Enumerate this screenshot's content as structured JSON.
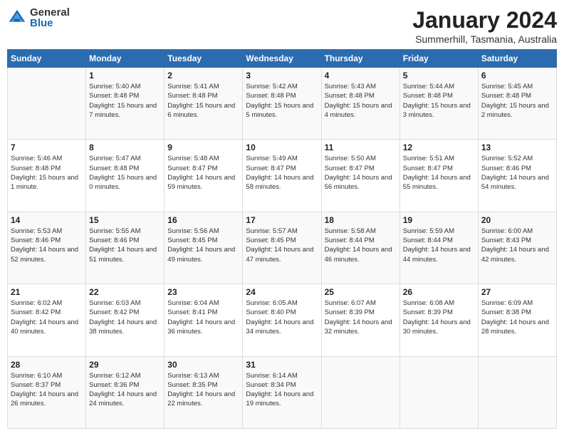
{
  "logo": {
    "general": "General",
    "blue": "Blue"
  },
  "header": {
    "month": "January 2024",
    "location": "Summerhill, Tasmania, Australia"
  },
  "days_of_week": [
    "Sunday",
    "Monday",
    "Tuesday",
    "Wednesday",
    "Thursday",
    "Friday",
    "Saturday"
  ],
  "weeks": [
    [
      {
        "day": "",
        "sunrise": "",
        "sunset": "",
        "daylight": ""
      },
      {
        "day": "1",
        "sunrise": "Sunrise: 5:40 AM",
        "sunset": "Sunset: 8:48 PM",
        "daylight": "Daylight: 15 hours and 7 minutes."
      },
      {
        "day": "2",
        "sunrise": "Sunrise: 5:41 AM",
        "sunset": "Sunset: 8:48 PM",
        "daylight": "Daylight: 15 hours and 6 minutes."
      },
      {
        "day": "3",
        "sunrise": "Sunrise: 5:42 AM",
        "sunset": "Sunset: 8:48 PM",
        "daylight": "Daylight: 15 hours and 5 minutes."
      },
      {
        "day": "4",
        "sunrise": "Sunrise: 5:43 AM",
        "sunset": "Sunset: 8:48 PM",
        "daylight": "Daylight: 15 hours and 4 minutes."
      },
      {
        "day": "5",
        "sunrise": "Sunrise: 5:44 AM",
        "sunset": "Sunset: 8:48 PM",
        "daylight": "Daylight: 15 hours and 3 minutes."
      },
      {
        "day": "6",
        "sunrise": "Sunrise: 5:45 AM",
        "sunset": "Sunset: 8:48 PM",
        "daylight": "Daylight: 15 hours and 2 minutes."
      }
    ],
    [
      {
        "day": "7",
        "sunrise": "Sunrise: 5:46 AM",
        "sunset": "Sunset: 8:48 PM",
        "daylight": "Daylight: 15 hours and 1 minute."
      },
      {
        "day": "8",
        "sunrise": "Sunrise: 5:47 AM",
        "sunset": "Sunset: 8:48 PM",
        "daylight": "Daylight: 15 hours and 0 minutes."
      },
      {
        "day": "9",
        "sunrise": "Sunrise: 5:48 AM",
        "sunset": "Sunset: 8:47 PM",
        "daylight": "Daylight: 14 hours and 59 minutes."
      },
      {
        "day": "10",
        "sunrise": "Sunrise: 5:49 AM",
        "sunset": "Sunset: 8:47 PM",
        "daylight": "Daylight: 14 hours and 58 minutes."
      },
      {
        "day": "11",
        "sunrise": "Sunrise: 5:50 AM",
        "sunset": "Sunset: 8:47 PM",
        "daylight": "Daylight: 14 hours and 56 minutes."
      },
      {
        "day": "12",
        "sunrise": "Sunrise: 5:51 AM",
        "sunset": "Sunset: 8:47 PM",
        "daylight": "Daylight: 14 hours and 55 minutes."
      },
      {
        "day": "13",
        "sunrise": "Sunrise: 5:52 AM",
        "sunset": "Sunset: 8:46 PM",
        "daylight": "Daylight: 14 hours and 54 minutes."
      }
    ],
    [
      {
        "day": "14",
        "sunrise": "Sunrise: 5:53 AM",
        "sunset": "Sunset: 8:46 PM",
        "daylight": "Daylight: 14 hours and 52 minutes."
      },
      {
        "day": "15",
        "sunrise": "Sunrise: 5:55 AM",
        "sunset": "Sunset: 8:46 PM",
        "daylight": "Daylight: 14 hours and 51 minutes."
      },
      {
        "day": "16",
        "sunrise": "Sunrise: 5:56 AM",
        "sunset": "Sunset: 8:45 PM",
        "daylight": "Daylight: 14 hours and 49 minutes."
      },
      {
        "day": "17",
        "sunrise": "Sunrise: 5:57 AM",
        "sunset": "Sunset: 8:45 PM",
        "daylight": "Daylight: 14 hours and 47 minutes."
      },
      {
        "day": "18",
        "sunrise": "Sunrise: 5:58 AM",
        "sunset": "Sunset: 8:44 PM",
        "daylight": "Daylight: 14 hours and 46 minutes."
      },
      {
        "day": "19",
        "sunrise": "Sunrise: 5:59 AM",
        "sunset": "Sunset: 8:44 PM",
        "daylight": "Daylight: 14 hours and 44 minutes."
      },
      {
        "day": "20",
        "sunrise": "Sunrise: 6:00 AM",
        "sunset": "Sunset: 8:43 PM",
        "daylight": "Daylight: 14 hours and 42 minutes."
      }
    ],
    [
      {
        "day": "21",
        "sunrise": "Sunrise: 6:02 AM",
        "sunset": "Sunset: 8:42 PM",
        "daylight": "Daylight: 14 hours and 40 minutes."
      },
      {
        "day": "22",
        "sunrise": "Sunrise: 6:03 AM",
        "sunset": "Sunset: 8:42 PM",
        "daylight": "Daylight: 14 hours and 38 minutes."
      },
      {
        "day": "23",
        "sunrise": "Sunrise: 6:04 AM",
        "sunset": "Sunset: 8:41 PM",
        "daylight": "Daylight: 14 hours and 36 minutes."
      },
      {
        "day": "24",
        "sunrise": "Sunrise: 6:05 AM",
        "sunset": "Sunset: 8:40 PM",
        "daylight": "Daylight: 14 hours and 34 minutes."
      },
      {
        "day": "25",
        "sunrise": "Sunrise: 6:07 AM",
        "sunset": "Sunset: 8:39 PM",
        "daylight": "Daylight: 14 hours and 32 minutes."
      },
      {
        "day": "26",
        "sunrise": "Sunrise: 6:08 AM",
        "sunset": "Sunset: 8:39 PM",
        "daylight": "Daylight: 14 hours and 30 minutes."
      },
      {
        "day": "27",
        "sunrise": "Sunrise: 6:09 AM",
        "sunset": "Sunset: 8:38 PM",
        "daylight": "Daylight: 14 hours and 28 minutes."
      }
    ],
    [
      {
        "day": "28",
        "sunrise": "Sunrise: 6:10 AM",
        "sunset": "Sunset: 8:37 PM",
        "daylight": "Daylight: 14 hours and 26 minutes."
      },
      {
        "day": "29",
        "sunrise": "Sunrise: 6:12 AM",
        "sunset": "Sunset: 8:36 PM",
        "daylight": "Daylight: 14 hours and 24 minutes."
      },
      {
        "day": "30",
        "sunrise": "Sunrise: 6:13 AM",
        "sunset": "Sunset: 8:35 PM",
        "daylight": "Daylight: 14 hours and 22 minutes."
      },
      {
        "day": "31",
        "sunrise": "Sunrise: 6:14 AM",
        "sunset": "Sunset: 8:34 PM",
        "daylight": "Daylight: 14 hours and 19 minutes."
      },
      {
        "day": "",
        "sunrise": "",
        "sunset": "",
        "daylight": ""
      },
      {
        "day": "",
        "sunrise": "",
        "sunset": "",
        "daylight": ""
      },
      {
        "day": "",
        "sunrise": "",
        "sunset": "",
        "daylight": ""
      }
    ]
  ]
}
